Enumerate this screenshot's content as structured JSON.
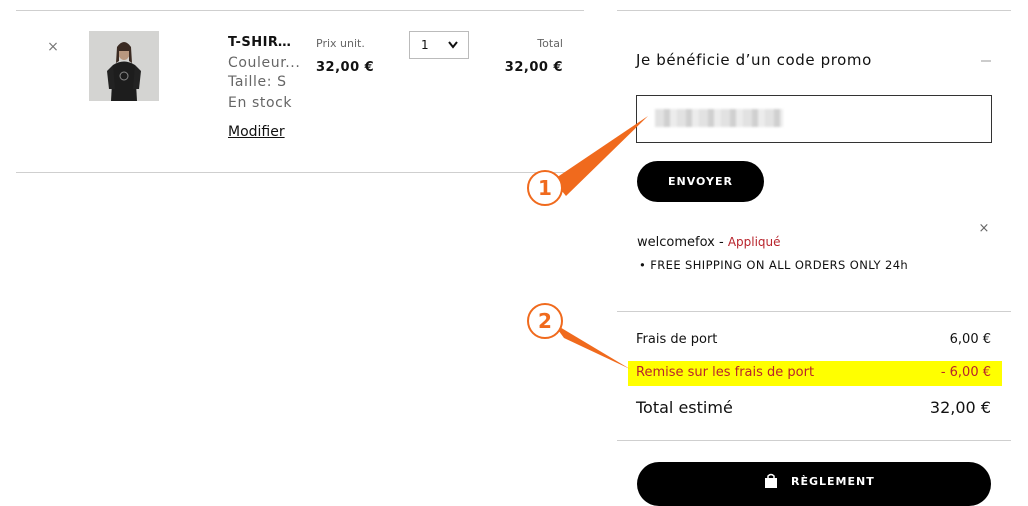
{
  "cart": {
    "remove_symbol": "×",
    "product": {
      "name": "T-SHIRT ...",
      "color_label": "Couleur...",
      "size_label": "Taille: S",
      "stock": "En stock",
      "modify_link": "Modifier"
    },
    "unit_price_label": "Prix unit.",
    "unit_price": "32,00 €",
    "quantity": "1",
    "total_label": "Total",
    "total": "32,00 €"
  },
  "promo": {
    "title": "Je bénéficie d’un code promo",
    "input_value": "",
    "send_button": "ENVOYER",
    "applied_code": "welcomefox",
    "applied_separator": " - ",
    "applied_status": "Appliqué",
    "remove_symbol": "×",
    "benefit": "FREE SHIPPING ON ALL ORDERS ONLY 24h"
  },
  "summary": {
    "shipping_label": "Frais de port",
    "shipping_value": "6,00 €",
    "discount_label": "Remise sur les frais de port",
    "discount_value": "- 6,00 €",
    "total_label": "Total estimé",
    "total_value": "32,00 €",
    "checkout_button": "RÈGLEMENT"
  },
  "annotations": {
    "marker_1": "1",
    "marker_2": "2"
  },
  "colors": {
    "annotation_orange": "#f06a1d",
    "highlight_yellow": "#ffff00",
    "applied_red": "#b8242c",
    "button_black": "#000000"
  }
}
